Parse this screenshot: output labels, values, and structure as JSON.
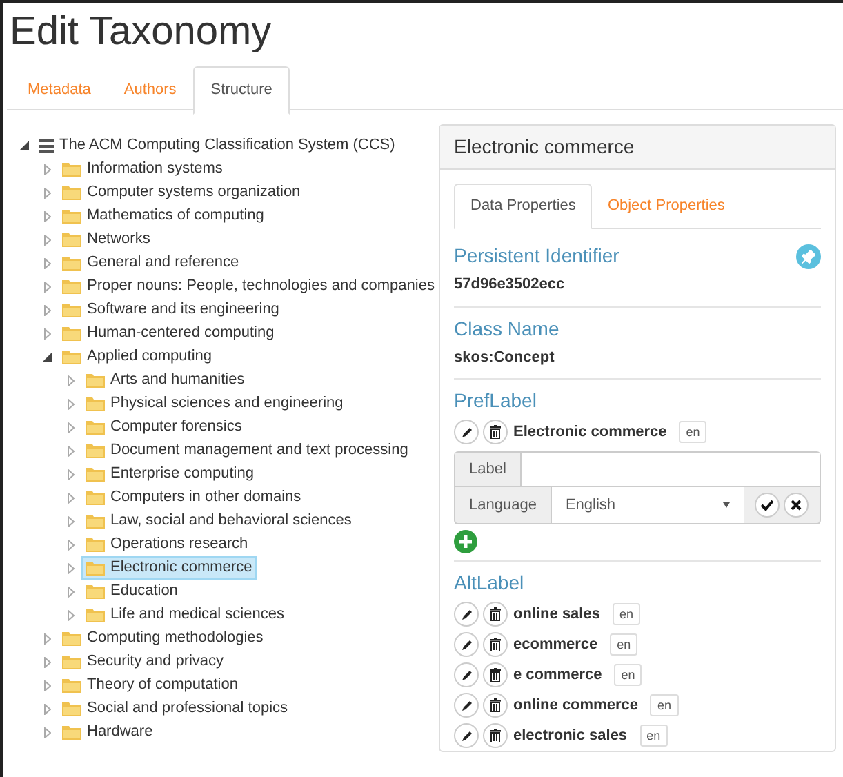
{
  "page_title": "Edit Taxonomy",
  "tabs": [
    {
      "label": "Metadata",
      "selected": false
    },
    {
      "label": "Authors",
      "selected": false
    },
    {
      "label": "Structure",
      "selected": true
    }
  ],
  "tree": [
    {
      "label": "The ACM Computing Classification System (CCS)",
      "kind": "root",
      "expanded": true,
      "selected": false,
      "children": [
        {
          "label": "Information systems",
          "kind": "folder",
          "expanded": false,
          "selected": false
        },
        {
          "label": "Computer systems organization",
          "kind": "folder",
          "expanded": false,
          "selected": false
        },
        {
          "label": "Mathematics of computing",
          "kind": "folder",
          "expanded": false,
          "selected": false
        },
        {
          "label": "Networks",
          "kind": "folder",
          "expanded": false,
          "selected": false
        },
        {
          "label": "General and reference",
          "kind": "folder",
          "expanded": false,
          "selected": false
        },
        {
          "label": "Proper nouns: People, technologies and companies",
          "kind": "folder",
          "expanded": false,
          "selected": false
        },
        {
          "label": "Software and its engineering",
          "kind": "folder",
          "expanded": false,
          "selected": false
        },
        {
          "label": "Human-centered computing",
          "kind": "folder",
          "expanded": false,
          "selected": false
        },
        {
          "label": "Applied computing",
          "kind": "folder",
          "expanded": true,
          "selected": false,
          "children": [
            {
              "label": "Arts and humanities",
              "kind": "folder",
              "expanded": false,
              "selected": false
            },
            {
              "label": "Physical sciences and engineering",
              "kind": "folder",
              "expanded": false,
              "selected": false
            },
            {
              "label": "Computer forensics",
              "kind": "folder",
              "expanded": false,
              "selected": false
            },
            {
              "label": "Document management and text processing",
              "kind": "folder",
              "expanded": false,
              "selected": false
            },
            {
              "label": "Enterprise computing",
              "kind": "folder",
              "expanded": false,
              "selected": false
            },
            {
              "label": "Computers in other domains",
              "kind": "folder",
              "expanded": false,
              "selected": false
            },
            {
              "label": "Law, social and behavioral sciences",
              "kind": "folder",
              "expanded": false,
              "selected": false
            },
            {
              "label": "Operations research",
              "kind": "folder",
              "expanded": false,
              "selected": false
            },
            {
              "label": "Electronic commerce",
              "kind": "folder",
              "expanded": false,
              "selected": true
            },
            {
              "label": "Education",
              "kind": "folder",
              "expanded": false,
              "selected": false
            },
            {
              "label": "Life and medical sciences",
              "kind": "folder",
              "expanded": false,
              "selected": false
            }
          ]
        },
        {
          "label": "Computing methodologies",
          "kind": "folder",
          "expanded": false,
          "selected": false
        },
        {
          "label": "Security and privacy",
          "kind": "folder",
          "expanded": false,
          "selected": false
        },
        {
          "label": "Theory of computation",
          "kind": "folder",
          "expanded": false,
          "selected": false
        },
        {
          "label": "Social and professional topics",
          "kind": "folder",
          "expanded": false,
          "selected": false
        },
        {
          "label": "Hardware",
          "kind": "folder",
          "expanded": false,
          "selected": false
        }
      ]
    }
  ],
  "detail": {
    "title": "Electronic commerce",
    "tabs": [
      {
        "label": "Data Properties",
        "selected": true
      },
      {
        "label": "Object Properties",
        "selected": false
      }
    ],
    "persistent_identifier": {
      "heading": "Persistent Identifier",
      "value": "57d96e3502ecc"
    },
    "class_name": {
      "heading": "Class Name",
      "value": "skos:Concept"
    },
    "pref_label": {
      "heading": "PrefLabel",
      "items": [
        {
          "text": "Electronic commerce",
          "lang": "en"
        }
      ],
      "form": {
        "label_caption": "Label",
        "language_caption": "Language",
        "language_value": "English"
      }
    },
    "alt_label": {
      "heading": "AltLabel",
      "items": [
        {
          "text": "online sales",
          "lang": "en"
        },
        {
          "text": "ecommerce",
          "lang": "en"
        },
        {
          "text": "e commerce",
          "lang": "en"
        },
        {
          "text": "online commerce",
          "lang": "en"
        },
        {
          "text": "electronic sales",
          "lang": "en"
        }
      ]
    }
  }
}
